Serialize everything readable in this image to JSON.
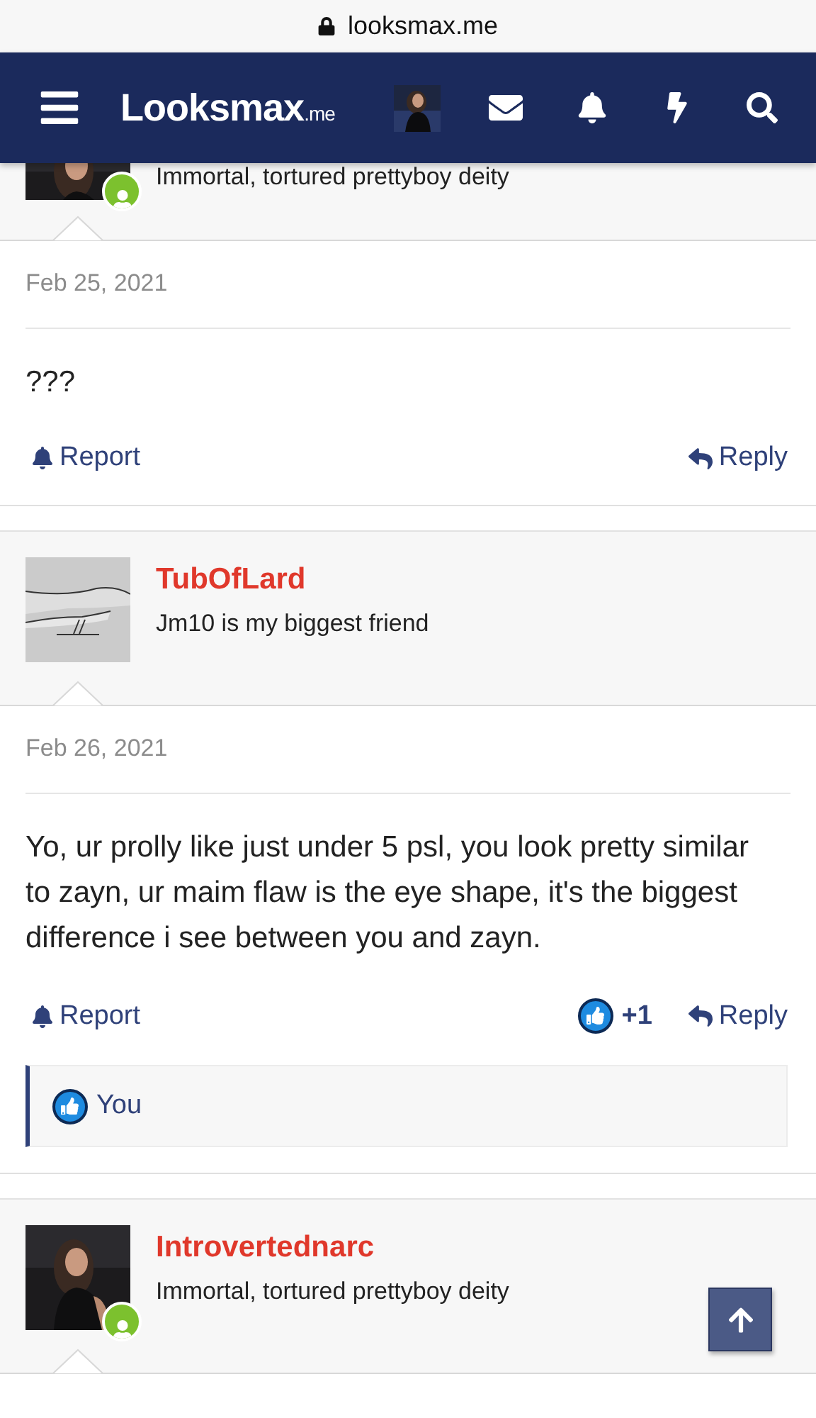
{
  "browser": {
    "url": "looksmax.me"
  },
  "nav": {
    "logo": "Looksmax",
    "logo_suffix": ".me"
  },
  "posts": [
    {
      "kind": "partial",
      "user": {
        "title": "Immortal, tortured prettyboy deity",
        "online": true
      },
      "date": "Feb 25, 2021",
      "body": "???",
      "actions": {
        "report": "Report",
        "reply": "Reply"
      }
    },
    {
      "kind": "full",
      "user": {
        "name": "TubOfLard",
        "title": "Jm10 is my biggest friend",
        "online": false
      },
      "date": "Feb 26, 2021",
      "body": "Yo, ur prolly like just under 5 psl, you look pretty similar to zayn, ur maim flaw is the eye shape, it's the biggest difference i see between you and zayn.",
      "likes": "+1",
      "reactions": [
        "You"
      ],
      "actions": {
        "report": "Report",
        "reply": "Reply"
      }
    },
    {
      "kind": "header",
      "user": {
        "name": "Introvertednarc",
        "title": "Immortal, tortured prettyboy deity",
        "online": true
      }
    }
  ]
}
